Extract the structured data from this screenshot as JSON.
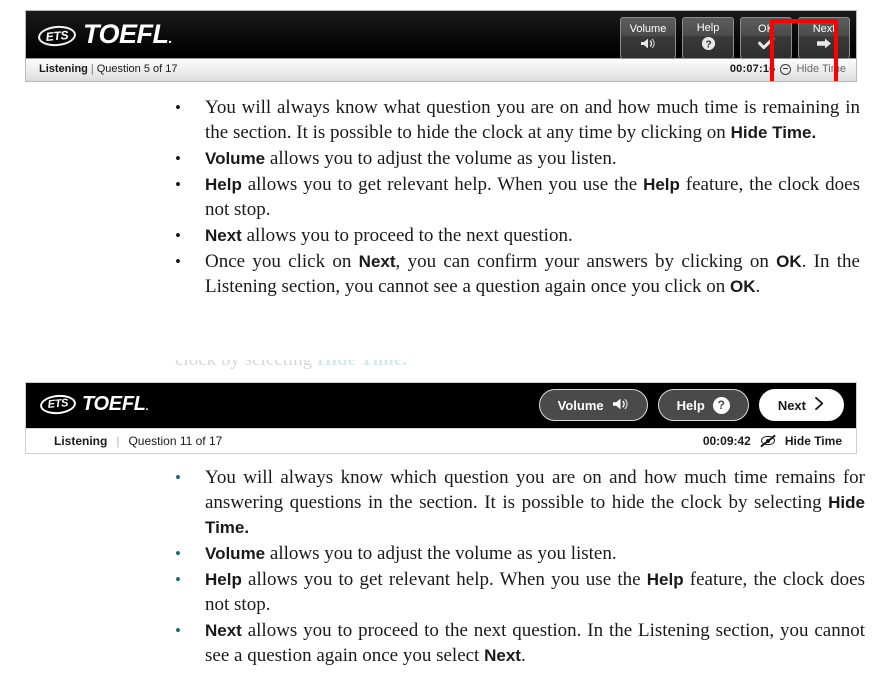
{
  "screenshot_top": {
    "brand": {
      "ets": "ETS",
      "toefl": "TOEFL",
      "trademark": "."
    },
    "buttons": [
      {
        "label": "Volume",
        "icon": "speaker-icon",
        "glyph": "🔈"
      },
      {
        "label": "Help",
        "icon": "question-circle-icon",
        "glyph": "?"
      },
      {
        "label": "OK",
        "icon": "checkmark-icon",
        "glyph": "✔"
      },
      {
        "label": "Next",
        "icon": "arrow-right-icon",
        "glyph": "➡"
      }
    ],
    "status": {
      "section": "Listening",
      "separator": "|",
      "question": "Question 5 of 17",
      "time": "00:07:16",
      "hide_icon": "minus-circle-icon",
      "hide_label": "Hide Time"
    },
    "highlight": {
      "target": "OK",
      "color": "#ff0000"
    }
  },
  "list_top": {
    "bullet": "•",
    "items": [
      [
        {
          "t": "You will always know what question you are on and how much time is remaining in the section. It is possible to hide the clock at any time by clicking on ",
          "b": false
        },
        {
          "t": "Hide Time.",
          "b": true
        }
      ],
      [
        {
          "t": "Volume",
          "b": true
        },
        {
          "t": " allows you to adjust the volume as you listen.",
          "b": false
        }
      ],
      [
        {
          "t": "Help",
          "b": true
        },
        {
          "t": " allows you to get relevant help. When you use the ",
          "b": false
        },
        {
          "t": "Help",
          "b": true
        },
        {
          "t": " feature, the clock does not stop.",
          "b": false
        }
      ],
      [
        {
          "t": "Next",
          "b": true
        },
        {
          "t": " allows you to proceed to the next question.",
          "b": false
        }
      ],
      [
        {
          "t": "Once you click on ",
          "b": false
        },
        {
          "t": "Next",
          "b": true
        },
        {
          "t": ", you can confirm your answers by clicking on ",
          "b": false
        },
        {
          "t": "OK",
          "b": true
        },
        {
          "t": ". In the Listening section, you cannot see a question again once you click on ",
          "b": false
        },
        {
          "t": "OK",
          "b": true
        },
        {
          "t": ".",
          "b": false
        }
      ]
    ]
  },
  "clipped_line": {
    "before": "clock by selecting ",
    "accent": "Hide Time.",
    "after": ""
  },
  "screenshot_bottom": {
    "brand": {
      "ets": "ETS",
      "toefl": "TOEFL",
      "trademark": "."
    },
    "buttons": [
      {
        "label": "Volume",
        "icon": "speaker-icon",
        "glyph": "🔈",
        "style": "dark"
      },
      {
        "label": "Help",
        "icon": "question-circle-icon",
        "glyph": "?",
        "style": "dark"
      },
      {
        "label": "Next",
        "icon": "chevron-right-icon",
        "glyph": "›",
        "style": "light"
      }
    ],
    "status": {
      "section": "Listening",
      "separator": "|",
      "question": "Question 11 of 17",
      "time": "00:09:42",
      "hide_icon": "eye-slash-icon",
      "hide_label": "Hide Time"
    }
  },
  "list_bottom": {
    "bullet": "•",
    "bullet_color": "#12707f",
    "items": [
      [
        {
          "t": "You will always know which question you are on and how much time remains for answering questions in the section. It is possible to hide the clock by selecting ",
          "b": false
        },
        {
          "t": "Hide Time.",
          "b": true
        }
      ],
      [
        {
          "t": "Volume",
          "b": true
        },
        {
          "t": " allows you to adjust the volume as you listen.",
          "b": false
        }
      ],
      [
        {
          "t": "Help",
          "b": true
        },
        {
          "t": " allows you to get relevant help. When you use the ",
          "b": false
        },
        {
          "t": "Help",
          "b": true
        },
        {
          "t": " feature, the clock does not stop.",
          "b": false
        }
      ],
      [
        {
          "t": "Next",
          "b": true
        },
        {
          "t": " allows you to proceed to the next question. In the Listening section, you cannot see a question again once you select ",
          "b": false
        },
        {
          "t": "Next",
          "b": true
        },
        {
          "t": ".",
          "b": false
        }
      ]
    ]
  }
}
